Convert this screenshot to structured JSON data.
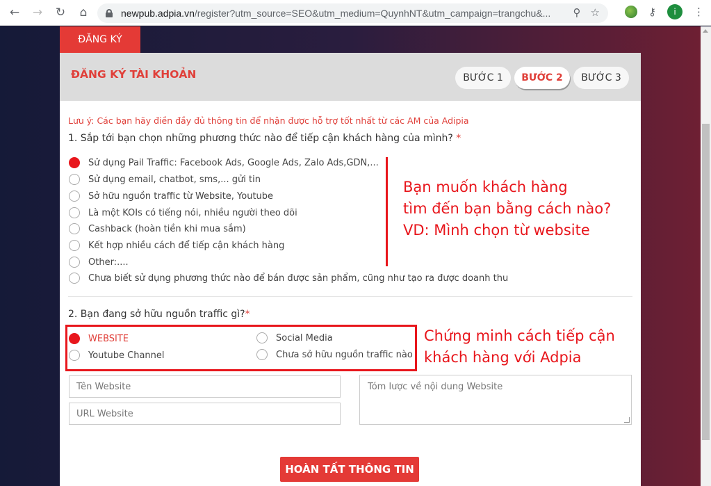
{
  "browser": {
    "url_host": "newpub.adpia.vn",
    "url_path": "/register?utm_source=SEO&utm_medium=QuynhNT&utm_campaign=trangchu&...",
    "avatar_letter": "i"
  },
  "page": {
    "tab_label": "ĐĂNG KÝ",
    "card_title": "ĐĂNG KÝ TÀI KHOẢN",
    "steps": [
      "BƯỚC 1",
      "BƯỚC 2",
      "BƯỚC 3"
    ],
    "note": "Lưu ý: Các bạn hãy điền đầy đủ thông tin để nhận được hỗ trợ tốt nhất từ các AM của Adipia",
    "q1": {
      "label": "1. Sắp tới bạn chọn những phương thức nào để tiếp cận khách hàng của mình?",
      "required": "*",
      "options": [
        "Sử dụng Pail Traffic: Facebook Ads, Google Ads, Zalo Ads,GDN,...",
        "Sử dụng email, chatbot, sms,... gửi tin",
        "Sở hữu nguồn traffic từ Website, Youtube",
        "Là một KOIs có tiếng nói, nhiều người theo dõi",
        "Cashback (hoàn tiền khi mua sắm)",
        "Kết hợp nhiều cách để tiếp cận khách hàng",
        "Other:....",
        "Chưa biết sử dụng phương thức nào để bán được sản phẩm, cũng như tạo ra được doanh thu"
      ],
      "selected_index": 0
    },
    "q2": {
      "label": "2. Bạn đang sở hữu nguồn traffic gì?",
      "required": "*",
      "options": [
        "WEBSITE",
        "Social Media",
        "Youtube Channel",
        "Chưa sở hữu nguồn traffic nào"
      ],
      "selected_index": 0
    },
    "fields": {
      "website_name_placeholder": "Tên Website",
      "website_url_placeholder": "URL Website",
      "summary_placeholder": "Tóm lược về nội dung Website"
    },
    "submit_label": "HOÀN TẤT THÔNG TIN"
  },
  "annotations": {
    "first": [
      "Bạn muốn khách hàng",
      "tìm đến bạn bằng cách nào?",
      "VD: Mình chọn từ website"
    ],
    "second": [
      "Chứng minh cách tiếp cận",
      "khách hàng với Adpia"
    ],
    "color": "#e8161c"
  }
}
